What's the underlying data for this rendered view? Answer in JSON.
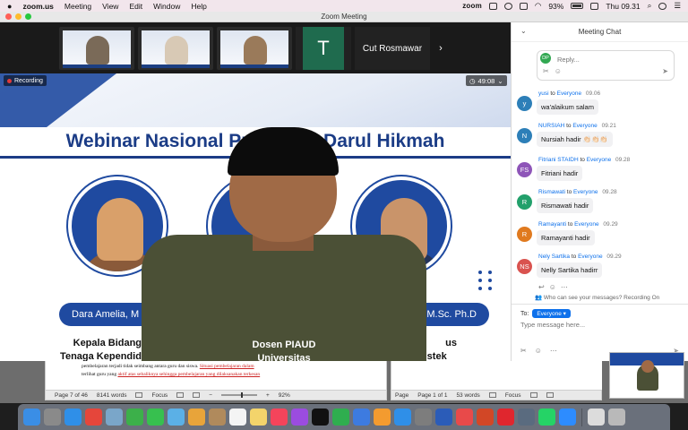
{
  "menubar": {
    "app": "zoom.us",
    "items": [
      "Meeting",
      "View",
      "Edit",
      "Window",
      "Help"
    ],
    "zoom_logo": "zoom",
    "battery": "93%",
    "clock": "Thu 09.31"
  },
  "window": {
    "title": "Zoom Meeting"
  },
  "participants": {
    "avatar_letter": "T",
    "name_tile": "Cut Rosmawar",
    "next": "›"
  },
  "recording": {
    "label": "Recording"
  },
  "timer": {
    "value": "49:08"
  },
  "slide": {
    "title": "Webinar Nasional Prog              STAI Darul Hikmah",
    "speaker1_name": "Dara Amelia, M",
    "speaker3_name": "d M.Sc. Ph.D",
    "role1_line1": "Kepala Bidang Guru &",
    "role1_line2": "Tenaga Kependidikan Dinas",
    "role2_line1": "Dosen PIAUD",
    "role2_line2": "Universitas",
    "role3_line1": "us",
    "role3_line2": "Mendikbudristek"
  },
  "chat": {
    "title": "Meeting Chat",
    "reply_avatar": "DP",
    "reply_placeholder": "Reply...",
    "messages": [
      {
        "initials": "y",
        "color": "#2d7fb8",
        "sender": "yusi",
        "to": "to",
        "recipient": "Everyone",
        "time": "09.06",
        "text": "wa'alaikum salam"
      },
      {
        "initials": "N",
        "color": "#2d7fb8",
        "sender": "NURSIAH",
        "to": "to",
        "recipient": "Everyone",
        "time": "09.21",
        "text": "Nursiah hadir 👏🏻👏🏻👏🏻"
      },
      {
        "initials": "FS",
        "color": "#8e55b8",
        "sender": "Fitriani STAIDH",
        "to": "to",
        "recipient": "Everyone",
        "time": "09.28",
        "text": "Fitriani hadir"
      },
      {
        "initials": "R",
        "color": "#22a06b",
        "sender": "Rismawati",
        "to": "to",
        "recipient": "Everyone",
        "time": "09.28",
        "text": "Rismawati hadir"
      },
      {
        "initials": "R",
        "color": "#e07a1f",
        "sender": "Ramayanti",
        "to": "to",
        "recipient": "Everyone",
        "time": "09.29",
        "text": "Ramayanti hadir"
      },
      {
        "initials": "NS",
        "color": "#d9534f",
        "sender": "Nely Sartika",
        "to": "to",
        "recipient": "Everyone",
        "time": "09.29",
        "text": "Nelly Sartika hadirr"
      }
    ],
    "who_can_see": "Who can see your messages? Recording On",
    "to_label": "To:",
    "to_recipient": "Everyone ▾",
    "input_placeholder": "Type message here..."
  },
  "doc1": {
    "line1": "pembelajaran terjadi tidak seimbang antara guru dan siswa.",
    "line1_red": "Situasi pembelajaran dalam",
    "line2_start": "terlihat guru yang",
    "line2_red": "aktif atas sebaliknya sehingga pembelajaran yang dilaksanakan terkesan",
    "page": "Page 7 of 46",
    "words": "8141 words",
    "focus": "Focus",
    "zoom": "92%"
  },
  "doc2": {
    "page": "Page 1 of 1",
    "words": "53 words",
    "focus": "Focus",
    "page_partial": "Page"
  },
  "dock": {
    "icons": [
      {
        "name": "finder-icon",
        "color": "#3a8ee6"
      },
      {
        "name": "launchpad-icon",
        "color": "#8a8a8a"
      },
      {
        "name": "safari-icon",
        "color": "#2f8fe8"
      },
      {
        "name": "chrome-icon",
        "color": "#e5463b"
      },
      {
        "name": "preview-icon",
        "color": "#7aa6c9"
      },
      {
        "name": "facetime-icon",
        "color": "#3cb04a"
      },
      {
        "name": "messages-icon",
        "color": "#37c04f"
      },
      {
        "name": "maps-icon",
        "color": "#5bb0e6"
      },
      {
        "name": "photos-icon",
        "color": "#e8a43a"
      },
      {
        "name": "contacts-icon",
        "color": "#b08a5c"
      },
      {
        "name": "calendar-icon",
        "color": "#f4f4f4"
      },
      {
        "name": "notes-icon",
        "color": "#f3d46b"
      },
      {
        "name": "music-icon",
        "color": "#f4445b"
      },
      {
        "name": "podcasts-icon",
        "color": "#9b4ce0"
      },
      {
        "name": "tv-icon",
        "color": "#111111"
      },
      {
        "name": "numbers-icon",
        "color": "#2fae4f"
      },
      {
        "name": "keynote-icon",
        "color": "#3d7be0"
      },
      {
        "name": "pages-icon",
        "color": "#f39b2f"
      },
      {
        "name": "appstore-icon",
        "color": "#2f8fe8"
      },
      {
        "name": "settings-icon",
        "color": "#7d7d7d"
      },
      {
        "name": "word-icon",
        "color": "#2b5cb8"
      },
      {
        "name": "mail-icon",
        "color": "#e84a4a"
      },
      {
        "name": "powerpoint-icon",
        "color": "#d24726"
      },
      {
        "name": "wps-icon",
        "color": "#e0262e"
      },
      {
        "name": "screen-icon",
        "color": "#5a6b7f"
      },
      {
        "name": "whatsapp-icon",
        "color": "#25d366"
      },
      {
        "name": "zoom-icon",
        "color": "#2d8cff"
      },
      {
        "name": "file-icon",
        "color": "#dcdcdc"
      },
      {
        "name": "trash-icon",
        "color": "#b9b9b9"
      }
    ]
  }
}
